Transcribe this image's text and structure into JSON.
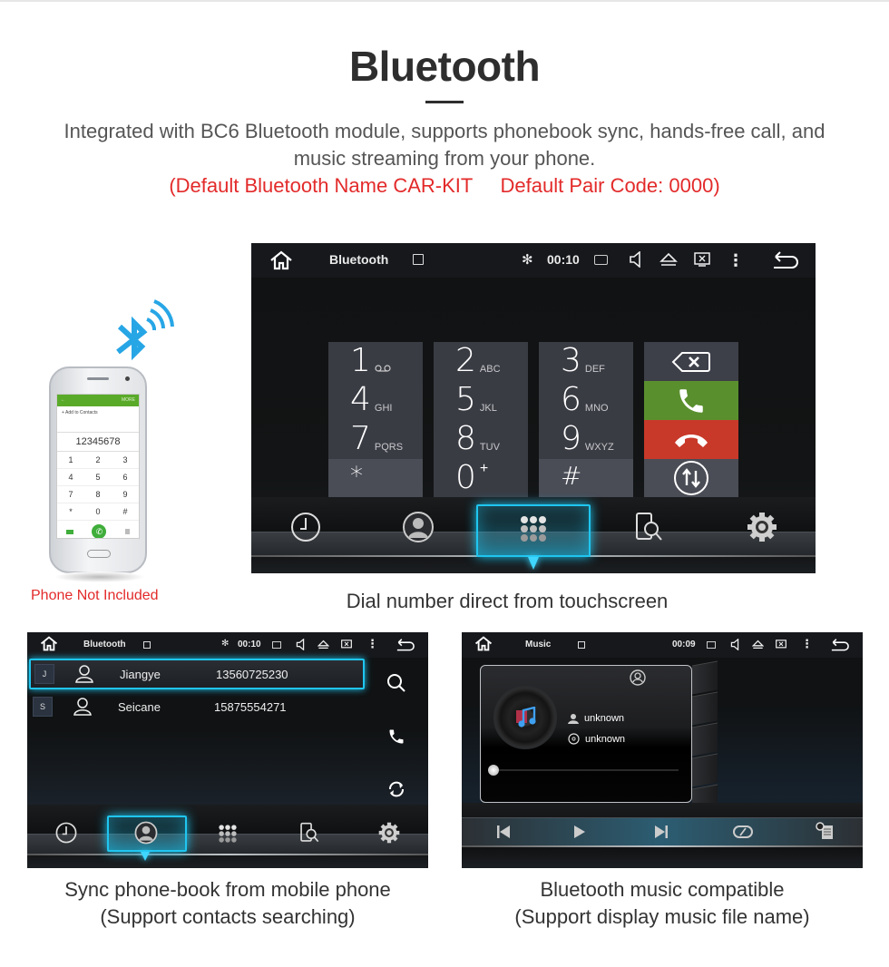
{
  "header": {
    "title": "Bluetooth",
    "description": "Integrated with BC6 Bluetooth module, supports phonebook sync, hands-free call, and music streaming from your phone.",
    "defaults_line": "(Default Bluetooth Name CAR-KIT     Default Pair Code: 0000)"
  },
  "colors": {
    "accent_red": "#e32a2a",
    "highlight_cyan": "#1fc6f0",
    "call_green": "#5a8f2e",
    "hangup_red": "#c8392a",
    "key_bg": "#3a3c44"
  },
  "phone_illustration": {
    "note": "Phone Not Included",
    "top_bar_action": "MORE",
    "add_contact": "Add to Contacts",
    "dialed_number": "12345678",
    "keys": [
      "1",
      "2",
      "3",
      "4",
      "5",
      "6",
      "7",
      "8",
      "9",
      "*",
      "0",
      "#"
    ]
  },
  "dial_screen": {
    "status": {
      "title": "Bluetooth",
      "time": "00:10"
    },
    "keys": [
      {
        "digit": "1",
        "letters": "oo"
      },
      {
        "digit": "2",
        "letters": "ABC"
      },
      {
        "digit": "3",
        "letters": "DEF"
      },
      {
        "digit": "4",
        "letters": "GHI"
      },
      {
        "digit": "5",
        "letters": "JKL"
      },
      {
        "digit": "6",
        "letters": "MNO"
      },
      {
        "digit": "7",
        "letters": "PQRS"
      },
      {
        "digit": "8",
        "letters": "TUV"
      },
      {
        "digit": "9",
        "letters": "WXYZ"
      },
      {
        "digit": "*",
        "letters": ""
      },
      {
        "digit": "0",
        "letters": "+"
      },
      {
        "digit": "#",
        "letters": ""
      }
    ],
    "dock": [
      "call-log",
      "contacts",
      "dialpad",
      "device-search",
      "settings"
    ],
    "dock_selected": "dialpad",
    "caption": "Dial number direct from touchscreen"
  },
  "phonebook_screen": {
    "status": {
      "title": "Bluetooth",
      "time": "00:10"
    },
    "contacts": [
      {
        "letter": "J",
        "name": "Jiangye",
        "number": "13560725230",
        "selected": true
      },
      {
        "letter": "S",
        "name": "Seicane",
        "number": "15875554271",
        "selected": false
      }
    ],
    "side_actions": [
      "search",
      "call",
      "sync"
    ],
    "dock": [
      "call-log",
      "contacts",
      "dialpad",
      "device-search",
      "settings"
    ],
    "dock_selected": "contacts",
    "caption_line1": "Sync phone-book from mobile phone",
    "caption_line2": "(Support contacts searching)"
  },
  "music_screen": {
    "status": {
      "title": "Music",
      "time": "00:09"
    },
    "artist": "unknown",
    "album": "unknown",
    "progress": 0,
    "controls": [
      "previous",
      "play",
      "next",
      "repeat",
      "playlist"
    ],
    "caption_line1": "Bluetooth music compatible",
    "caption_line2": "(Support display music file name)"
  }
}
